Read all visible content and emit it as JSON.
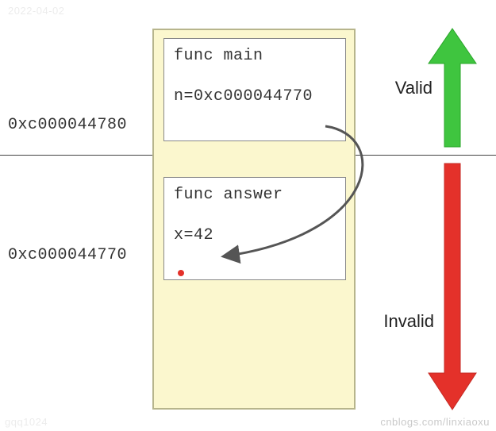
{
  "addresses": {
    "top": "0xc000044780",
    "bottom": "0xc000044770"
  },
  "frames": {
    "main": {
      "fn": "func main",
      "var": "n=0xc000044770"
    },
    "answer": {
      "fn": "func answer",
      "var": "x=42"
    }
  },
  "labels": {
    "valid": "Valid",
    "invalid": "Invalid"
  },
  "colors": {
    "valid_arrow": "#3fc53f",
    "invalid_arrow": "#e4312a",
    "pointer_arrow": "#555555"
  },
  "watermarks": {
    "top_left": "2022-04-02",
    "bottom_left": "gqq1024",
    "bottom_right": "cnblogs.com/linxiaoxu"
  },
  "chart_data": {
    "type": "diagram",
    "title": "Go stack frame pointer validity",
    "description": "A stack composed of two frames. Top frame 'func main' holds variable n whose value is the address 0xc000044770, which points into the lower frame 'func answer' where x=42 lives. Upward green arrow labels the region above the divider as Valid; downward red arrow labels the region below as Invalid.",
    "stack": [
      {
        "frame": "func main",
        "address": "0xc000044780",
        "variable": "n",
        "value": "0xc000044770",
        "region": "Valid"
      },
      {
        "frame": "func answer",
        "address": "0xc000044770",
        "variable": "x",
        "value": "42",
        "region": "Invalid"
      }
    ],
    "pointer": {
      "from_frame": "func main",
      "from_var": "n",
      "to_address": "0xc000044770",
      "to_var": "x"
    }
  }
}
